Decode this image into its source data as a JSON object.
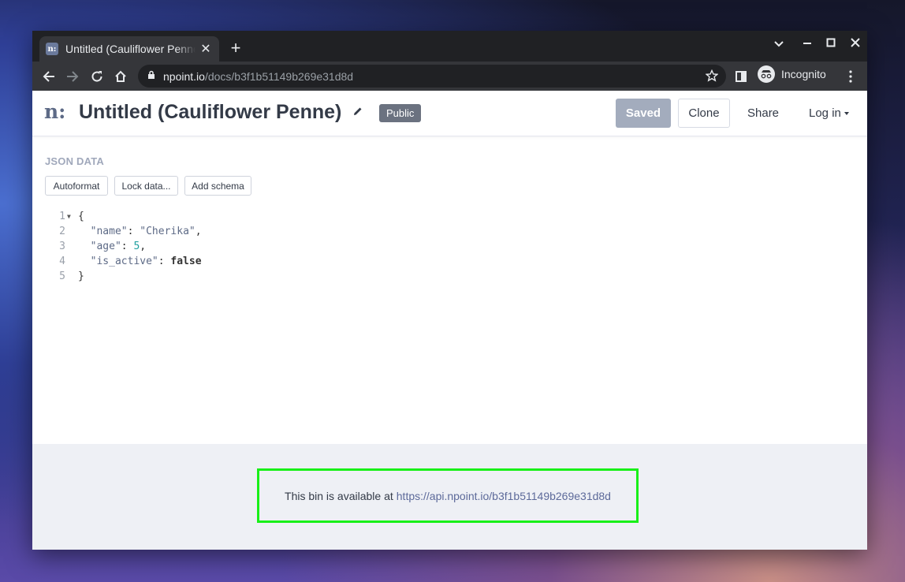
{
  "browser": {
    "tab_title": "Untitled (Cauliflower Penne)",
    "favicon_text": "n:",
    "url_host": "npoint.io",
    "url_path": "/docs/b3f1b51149b269e31d8d",
    "profile_label": "Incognito"
  },
  "header": {
    "logo": "n:",
    "title": "Untitled (Cauliflower Penne)",
    "visibility_badge": "Public",
    "saved_label": "Saved",
    "clone_label": "Clone",
    "share_label": "Share",
    "login_label": "Log in"
  },
  "editor": {
    "section_label": "JSON DATA",
    "buttons": {
      "autoformat": "Autoformat",
      "lock": "Lock data...",
      "schema": "Add schema"
    },
    "line_numbers": [
      "1",
      "2",
      "3",
      "4",
      "5"
    ],
    "lines": {
      "l1": "{",
      "l2_key": "\"name\"",
      "l2_val": "\"Cherika\"",
      "l3_key": "\"age\"",
      "l3_val": "5",
      "l4_key": "\"is_active\"",
      "l4_val": "false",
      "l5": "}"
    }
  },
  "footer": {
    "notice_text": "This bin is available at",
    "api_url": "https://api.npoint.io/b3f1b51149b269e31d8d"
  },
  "colors": {
    "highlight_border": "#18f018",
    "saved_button": "#a3acbd",
    "badge": "#6b7280"
  }
}
